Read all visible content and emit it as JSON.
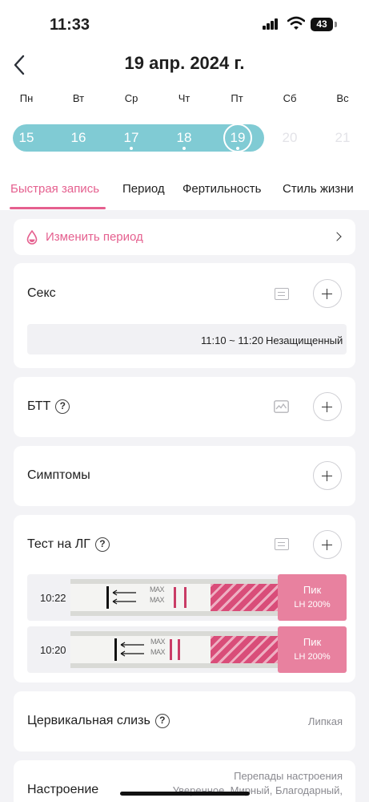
{
  "status_bar": {
    "time": "11:33",
    "battery": "43"
  },
  "header": {
    "title": "19 апр. 2024 г."
  },
  "calendar": {
    "weekdays": [
      "Пн",
      "Вт",
      "Ср",
      "Чт",
      "Пт",
      "Сб",
      "Вс"
    ],
    "days": [
      "15",
      "16",
      "17",
      "18",
      "19",
      "20",
      "21"
    ],
    "selected_day": "19",
    "period_color": "#80cbd4"
  },
  "tabs": [
    {
      "label": "Быстрая запись",
      "active": true
    },
    {
      "label": "Период"
    },
    {
      "label": "Фертильность"
    },
    {
      "label": "Стиль жизни"
    }
  ],
  "accent_color": "#e5608f",
  "change_period": {
    "label": "Изменить период",
    "icon": "drop-icon"
  },
  "sex": {
    "title": "Секс",
    "entry": {
      "time": "11:10 ~ 11:20",
      "type": "Незащищенный"
    }
  },
  "btt": {
    "title": "БТТ"
  },
  "symptoms": {
    "title": "Симптомы"
  },
  "lh_test": {
    "title": "Тест на ЛГ",
    "strip_text": "MAX",
    "entries": [
      {
        "time": "10:22",
        "result": "Пик",
        "value": "LH 200%"
      },
      {
        "time": "10:20",
        "result": "Пик",
        "value": "LH 200%"
      }
    ]
  },
  "cervical_mucus": {
    "title": "Цервикальная слизь",
    "value": "Липкая"
  },
  "mood": {
    "title": "Настроение",
    "line1": "Перепады настроения",
    "line2": "Уверенное, Мирный, Благодарный,"
  }
}
